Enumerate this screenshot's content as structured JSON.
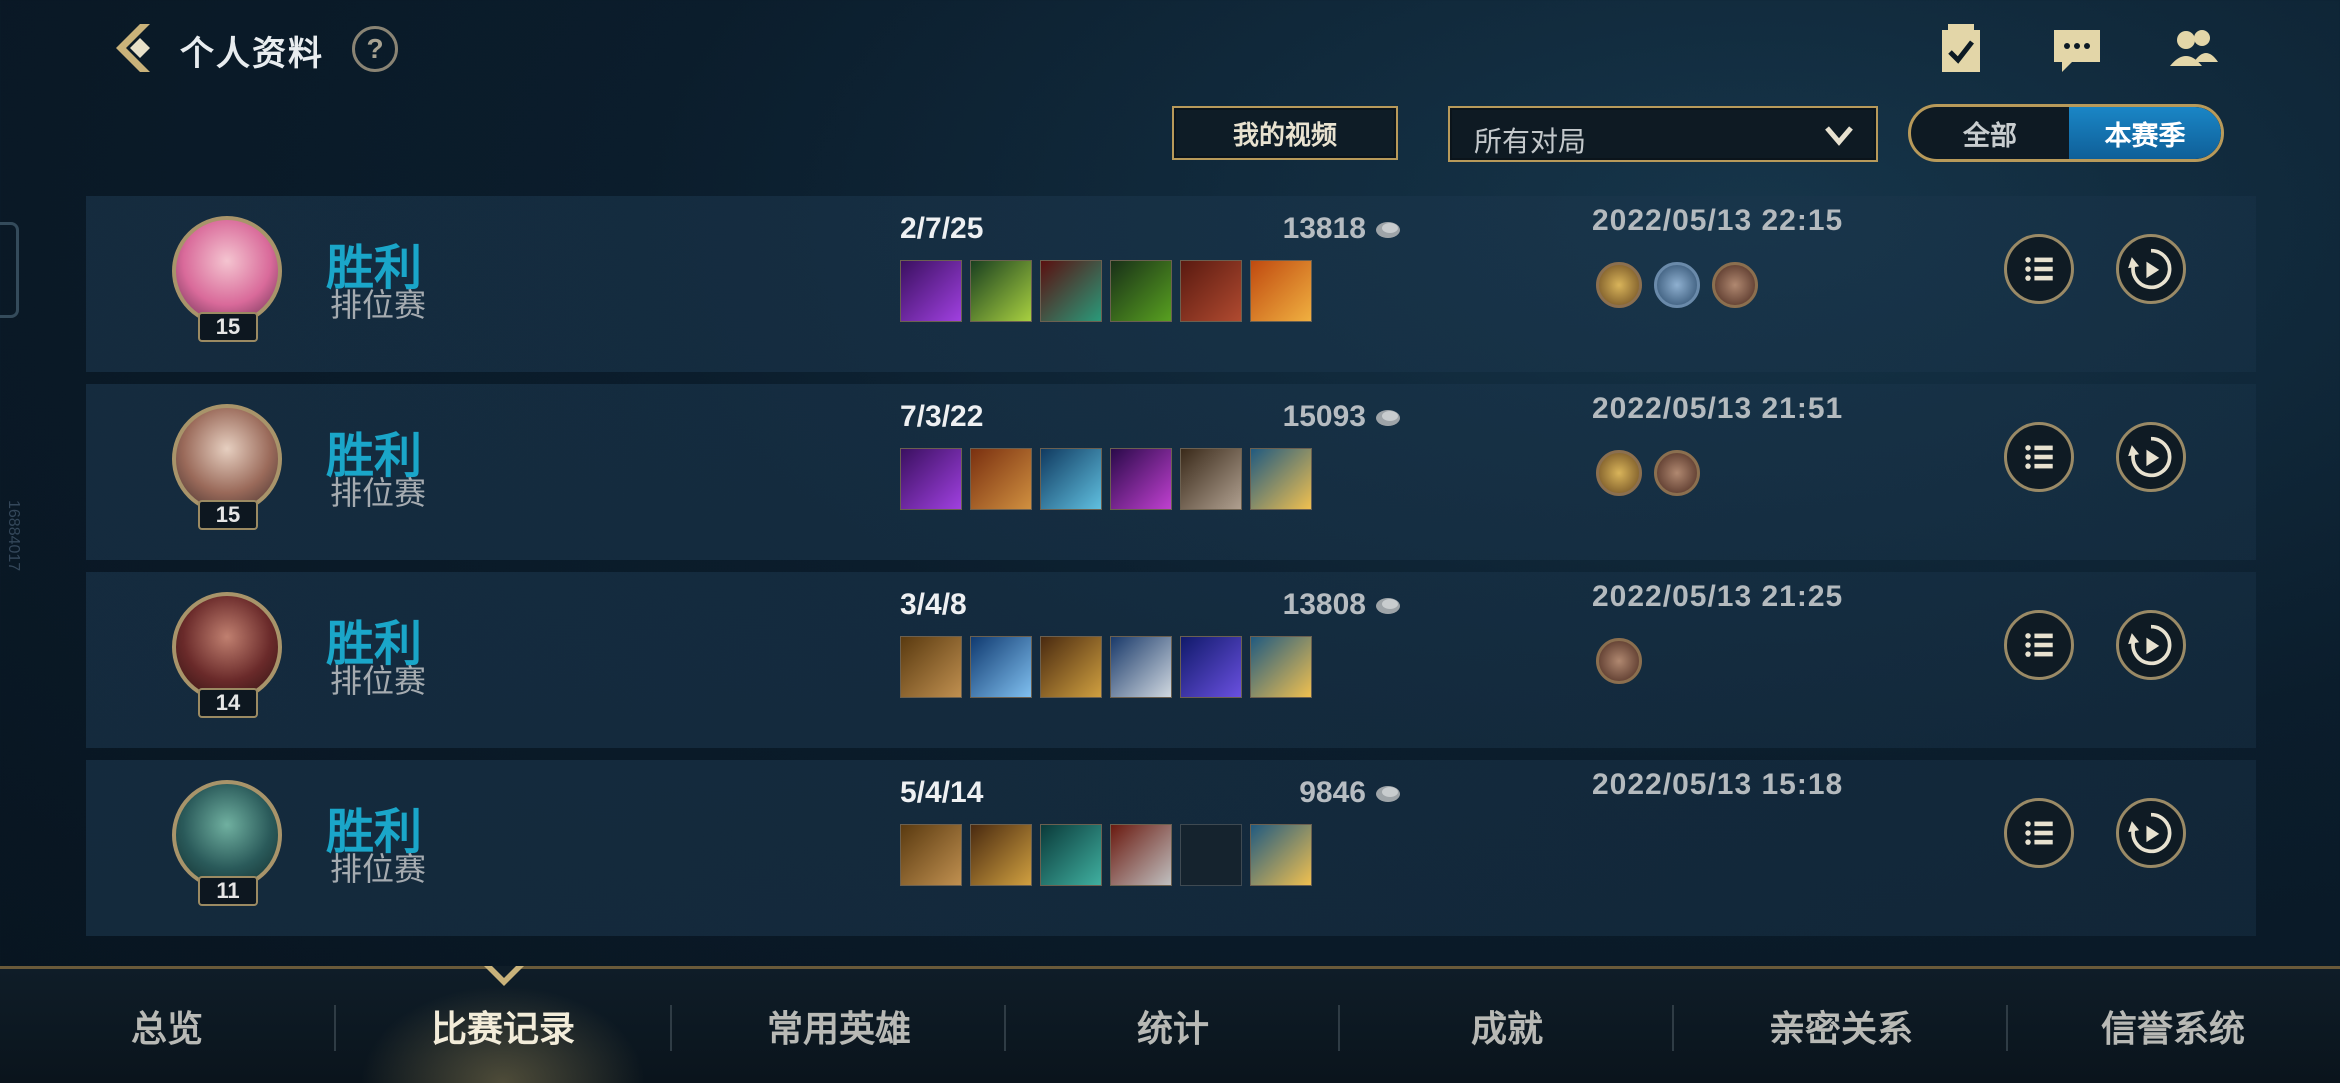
{
  "header": {
    "title": "个人资料",
    "help": "?",
    "icons": [
      "checklist-icon",
      "chat-icon",
      "friends-icon"
    ]
  },
  "filters": {
    "video_button": "我的视频",
    "match_type": "所有对局",
    "scope_options": [
      "全部",
      "本赛季"
    ],
    "scope_selected": "本赛季"
  },
  "matches": [
    {
      "result": "胜利",
      "mode": "排位赛",
      "level": "15",
      "kda": "2/7/25",
      "gold": "13818",
      "date": "2022/05/13 22:15",
      "badges": [
        "s-rank-badge",
        "ward-badge",
        "assist-badge"
      ]
    },
    {
      "result": "胜利",
      "mode": "排位赛",
      "level": "15",
      "kda": "7/3/22",
      "gold": "15093",
      "date": "2022/05/13 21:51",
      "badges": [
        "s-rank-badge",
        "objective-badge"
      ]
    },
    {
      "result": "胜利",
      "mode": "排位赛",
      "level": "14",
      "kda": "3/4/8",
      "gold": "13808",
      "date": "2022/05/13 21:25",
      "badges": [
        "assist-badge"
      ]
    },
    {
      "result": "胜利",
      "mode": "排位赛",
      "level": "11",
      "kda": "5/4/14",
      "gold": "9846",
      "date": "2022/05/13 15:18",
      "badges": []
    }
  ],
  "bottom_nav": {
    "items": [
      "总览",
      "比赛记录",
      "常用英雄",
      "统计",
      "成就",
      "亲密关系",
      "信誉系统"
    ],
    "active": "比赛记录"
  },
  "side_label": "16884017",
  "colors": {
    "accent_gold": "#b89a5a",
    "win_blue": "#1aa6c9",
    "season_blue": "#1a86c6"
  }
}
